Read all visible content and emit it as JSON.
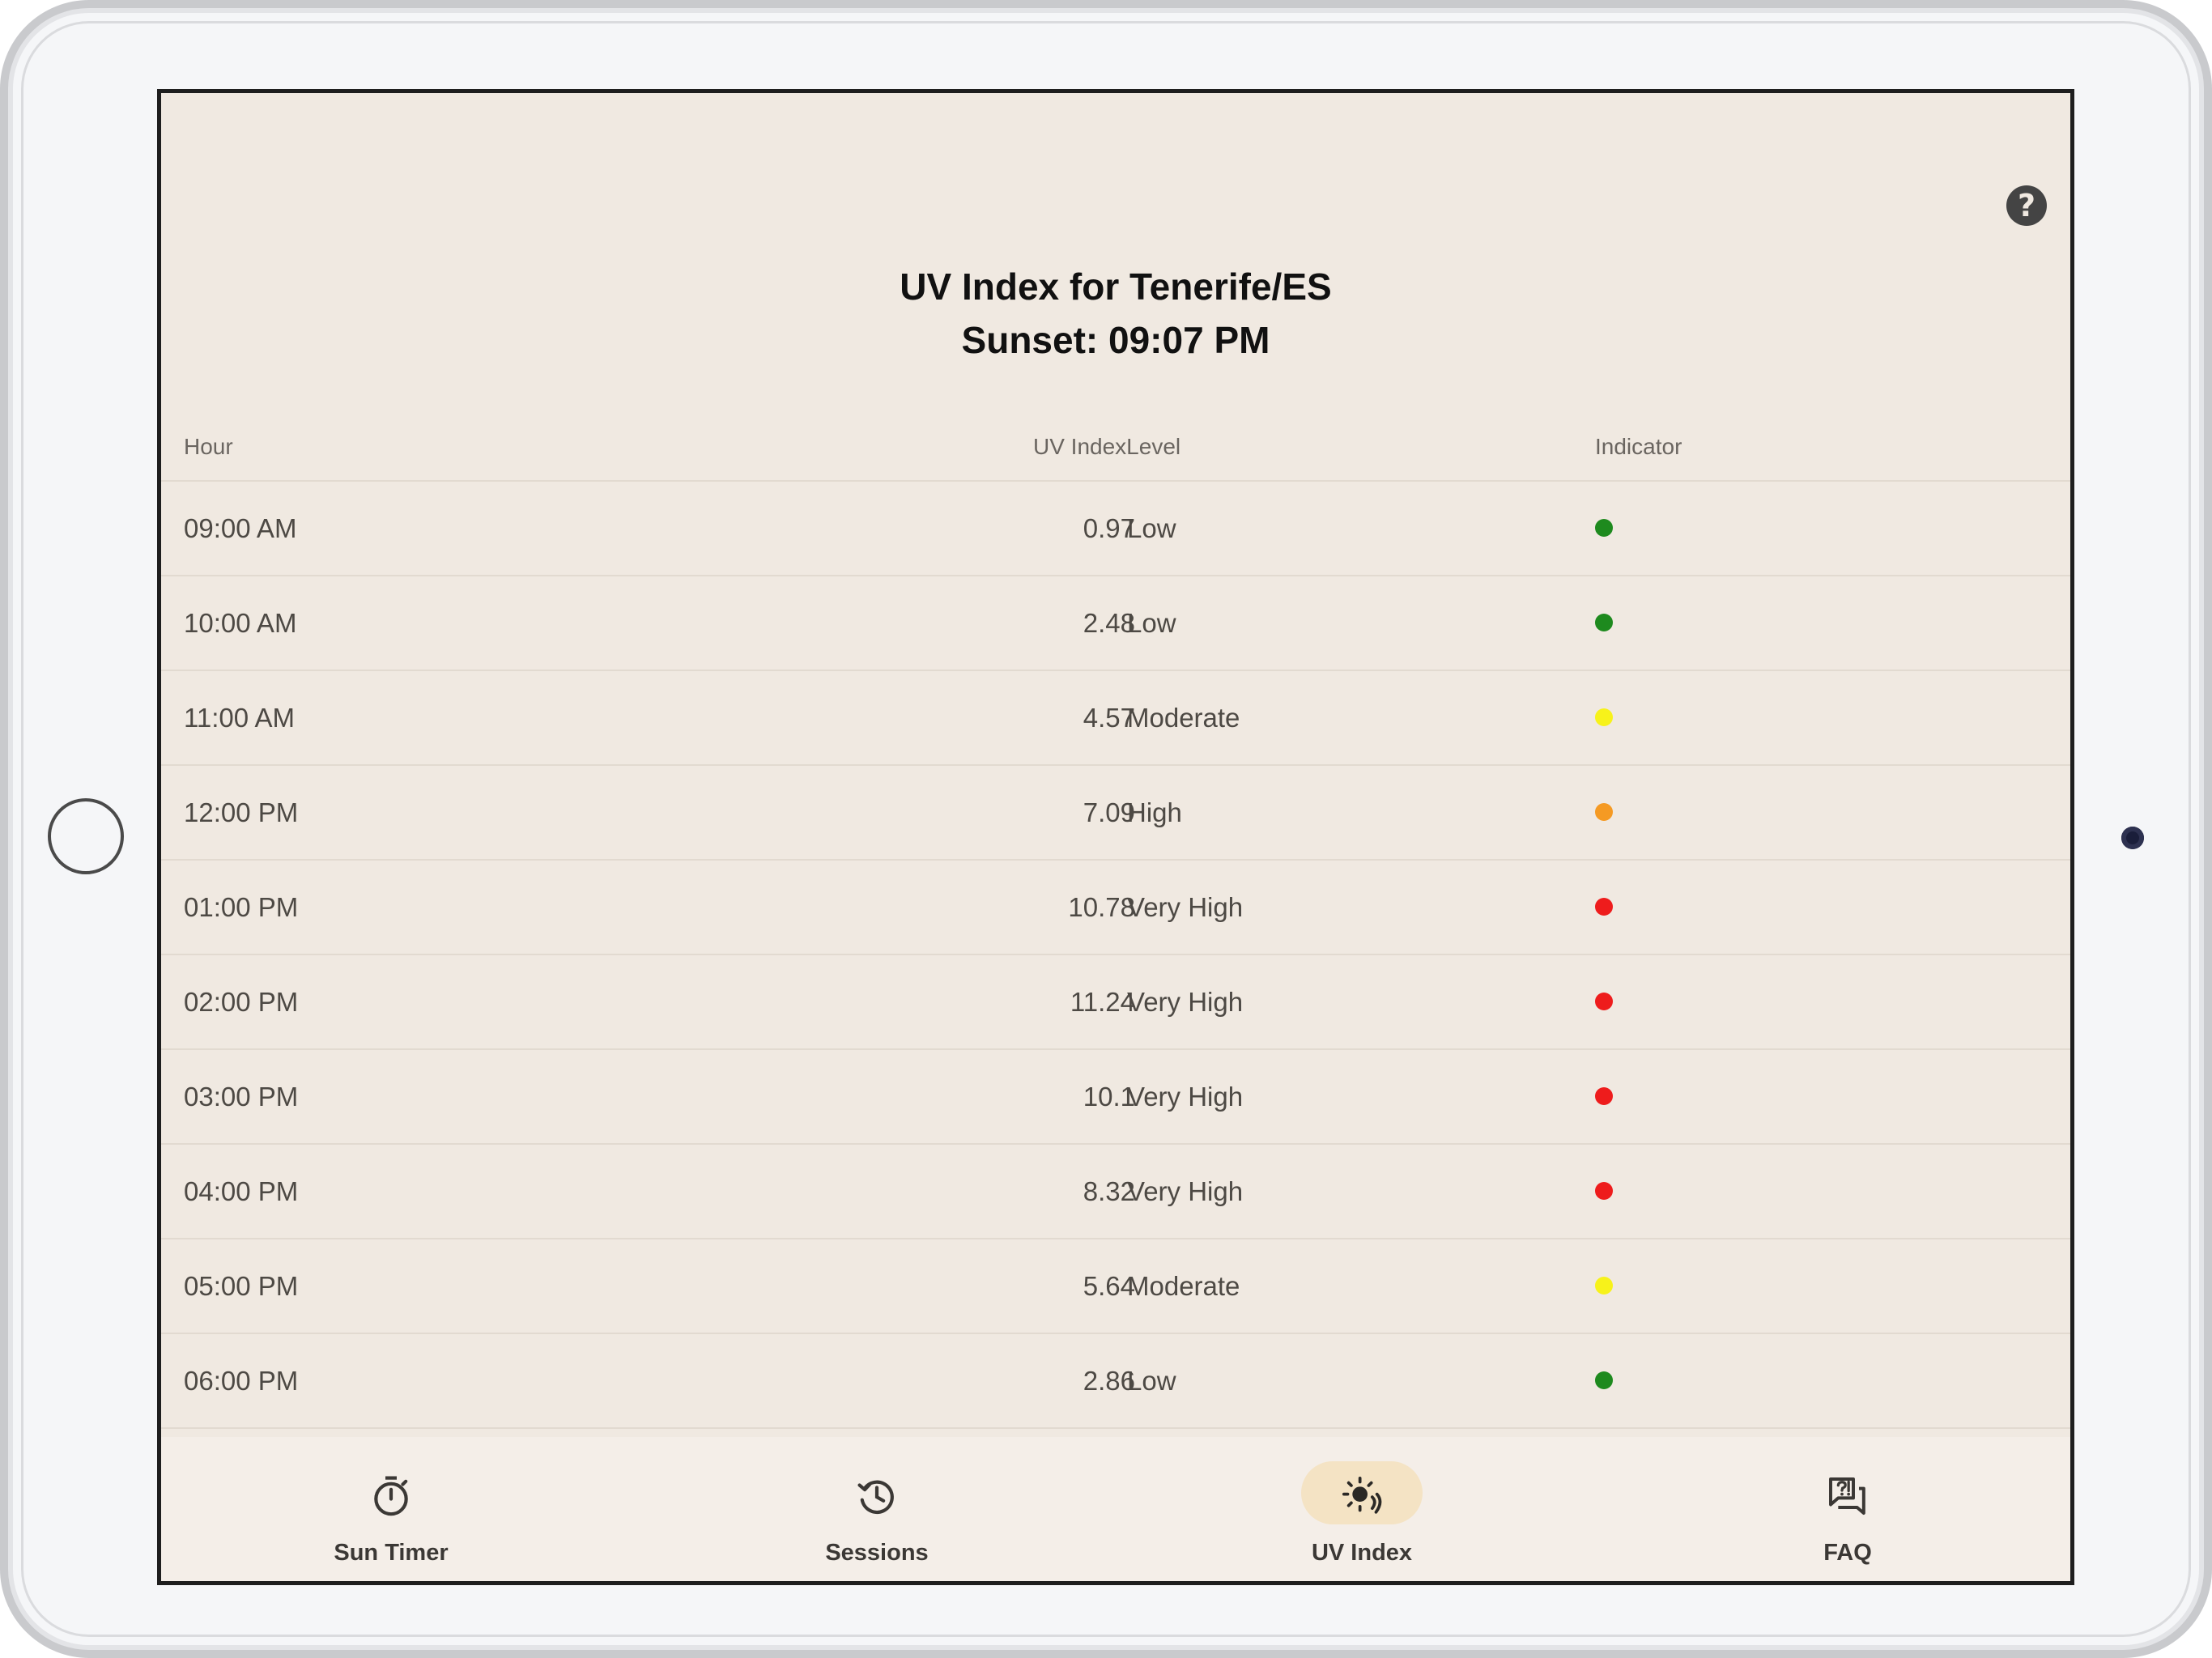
{
  "header": {
    "title_line1": "UV Index for Tenerife/ES",
    "title_line2": "Sunset: 09:07 PM",
    "help_icon": "help-circle-icon"
  },
  "table": {
    "columns": [
      "Hour",
      "UV IndexLevel",
      "Indicator"
    ],
    "rows": [
      {
        "hour": "09:00 AM",
        "uv": "0.97",
        "level": "Low",
        "color": "#1e8a1e"
      },
      {
        "hour": "10:00 AM",
        "uv": "2.48",
        "level": "Low",
        "color": "#1e8a1e"
      },
      {
        "hour": "11:00 AM",
        "uv": "4.57",
        "level": "Moderate",
        "color": "#f7f21a"
      },
      {
        "hour": "12:00 PM",
        "uv": "7.09",
        "level": "High",
        "color": "#f59a23"
      },
      {
        "hour": "01:00 PM",
        "uv": "10.78",
        "level": "Very High",
        "color": "#ee1c1c"
      },
      {
        "hour": "02:00 PM",
        "uv": "11.24",
        "level": "Very High",
        "color": "#ee1c1c"
      },
      {
        "hour": "03:00 PM",
        "uv": "10.1",
        "level": "Very High",
        "color": "#ee1c1c"
      },
      {
        "hour": "04:00 PM",
        "uv": "8.32",
        "level": "Very High",
        "color": "#ee1c1c"
      },
      {
        "hour": "05:00 PM",
        "uv": "5.64",
        "level": "Moderate",
        "color": "#f7f21a"
      },
      {
        "hour": "06:00 PM",
        "uv": "2.86",
        "level": "Low",
        "color": "#1e8a1e"
      }
    ]
  },
  "nav": {
    "items": [
      {
        "label": "Sun Timer",
        "icon": "stopwatch-icon",
        "active": false
      },
      {
        "label": "Sessions",
        "icon": "history-icon",
        "active": false
      },
      {
        "label": "UV Index",
        "icon": "sun-uv-icon",
        "active": true
      },
      {
        "label": "FAQ",
        "icon": "faq-icon",
        "active": false
      }
    ]
  },
  "colors": {
    "background": "#f0e9e1",
    "nav_background": "#f4eee8",
    "active_pill": "#f4e3c4"
  }
}
